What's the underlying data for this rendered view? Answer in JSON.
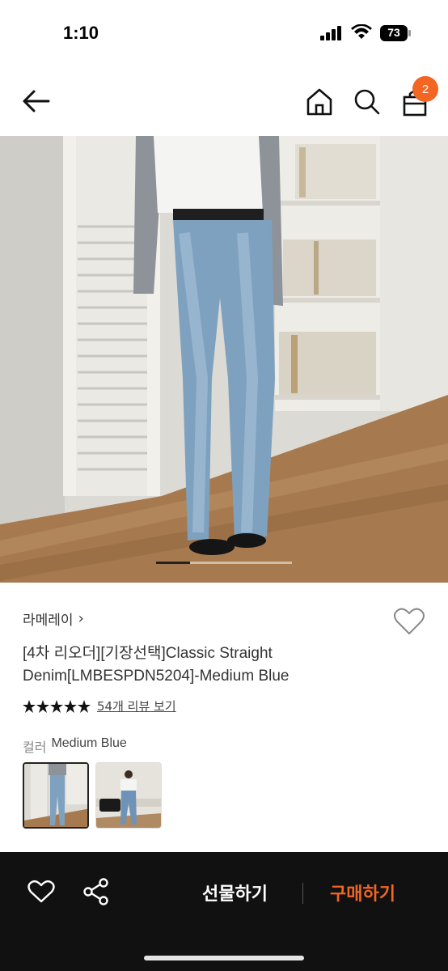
{
  "status_bar": {
    "time": "1:10",
    "battery": "73"
  },
  "header": {
    "cart_count": "2"
  },
  "product": {
    "brand": "라메레이",
    "brand_chevron": "›",
    "title": "[4차 리오더][기장선택]Classic Straight Denim[LMBESPDN5204]-Medium Blue",
    "rating_stars": 5,
    "review_link": "54개 리뷰 보기",
    "option_label": "컬러",
    "option_value": "Medium Blue",
    "image_page": 1,
    "image_page_count": 4
  },
  "bottom_bar": {
    "gift_label": "선물하기",
    "buy_label": "구매하기"
  },
  "icons": [
    "back-arrow-icon",
    "home-icon",
    "search-icon",
    "bag-icon",
    "heart-icon",
    "share-icon",
    "star-icon"
  ],
  "colors": {
    "accent": "#f26522",
    "bottom_bar": "#111111"
  }
}
